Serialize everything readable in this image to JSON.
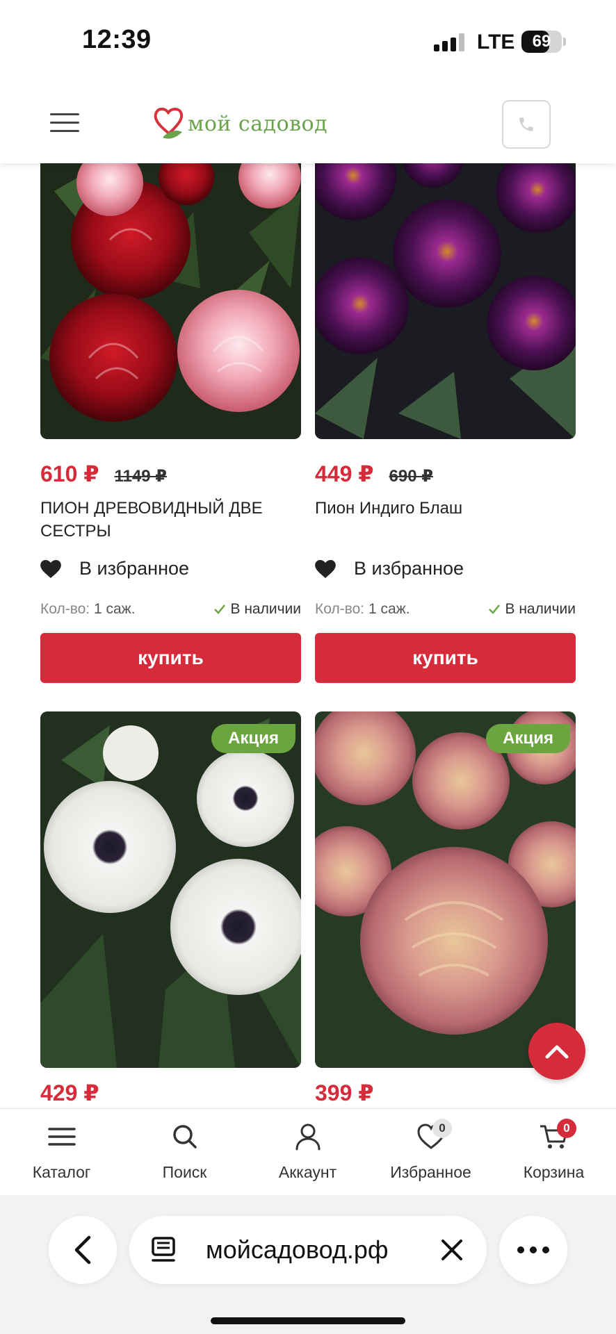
{
  "status_bar": {
    "time": "12:39",
    "network": "LTE",
    "battery": "69",
    "battery_level": 0.69
  },
  "header": {
    "logo_text": "мой садовод"
  },
  "products": [
    {
      "price": "610 ₽",
      "old_price": "1149 ₽",
      "title": "ПИОН ДРЕВОВИДНЫЙ ДВЕ СЕСТРЫ",
      "favorite_label": "В избранное",
      "qty_label": "Кол-во:",
      "qty_value": "1 саж.",
      "stock": "В наличии",
      "buy_label": "купить"
    },
    {
      "price": "449 ₽",
      "old_price": "690 ₽",
      "title": "Пион Индиго Блаш",
      "favorite_label": "В избранное",
      "qty_label": "Кол-во:",
      "qty_value": "1 саж.",
      "stock": "В наличии",
      "buy_label": "купить"
    },
    {
      "badge": "Акция",
      "price": "429 ₽"
    },
    {
      "badge": "Акция",
      "price": "399 ₽"
    }
  ],
  "bottom_nav": [
    {
      "label": "Каталог",
      "icon": "menu-icon"
    },
    {
      "label": "Поиск",
      "icon": "search-icon"
    },
    {
      "label": "Аккаунт",
      "icon": "user-icon"
    },
    {
      "label": "Избранное",
      "icon": "heart-icon",
      "count": "0"
    },
    {
      "label": "Корзина",
      "icon": "cart-icon",
      "count": "0"
    }
  ],
  "browser": {
    "url": "мойсадовод.рф"
  },
  "colors": {
    "accent": "#d52b3a",
    "badge": "#6ba53f",
    "logo": "#6aa34a"
  }
}
